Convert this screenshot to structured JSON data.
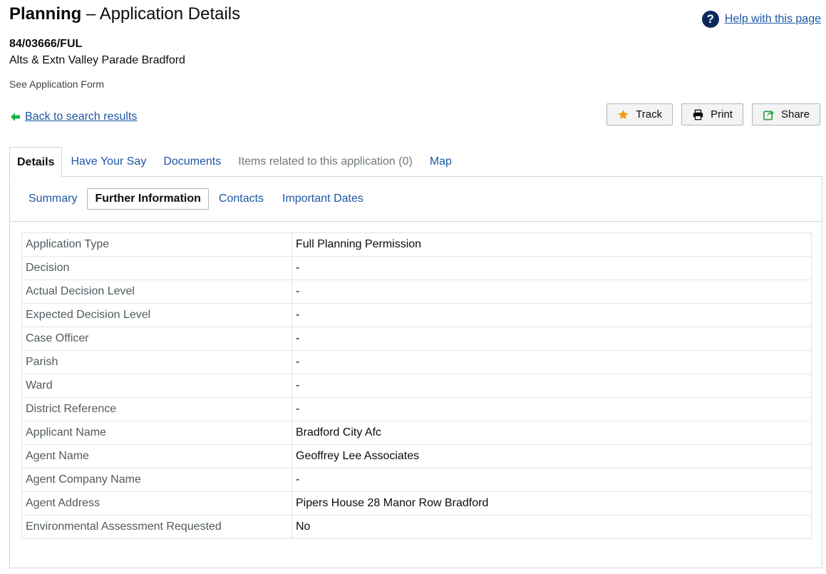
{
  "header": {
    "title_strong": "Planning",
    "title_rest": " – Application Details",
    "help_icon_glyph": "?",
    "help_link": "Help with this page"
  },
  "application": {
    "reference": "84/03666/FUL",
    "description": "Alts & Extn Valley Parade Bradford",
    "see_form": "See Application Form"
  },
  "navigation": {
    "back_link": "Back to search results",
    "back_icon": "arrow-left-icon"
  },
  "actions": {
    "track": "Track",
    "print": "Print",
    "share": "Share",
    "track_icon": "star-icon",
    "print_icon": "printer-icon",
    "share_icon": "share-icon"
  },
  "tabs": [
    {
      "label": "Details"
    },
    {
      "label": "Have Your Say"
    },
    {
      "label": "Documents"
    },
    {
      "label": "Items related to this application (0)"
    },
    {
      "label": "Map"
    }
  ],
  "subtabs": [
    {
      "label": "Summary"
    },
    {
      "label": "Further Information"
    },
    {
      "label": "Contacts"
    },
    {
      "label": "Important Dates"
    }
  ],
  "details": [
    {
      "label": "Application Type",
      "value": "Full Planning Permission"
    },
    {
      "label": "Decision",
      "value": "-"
    },
    {
      "label": "Actual Decision Level",
      "value": "-"
    },
    {
      "label": "Expected Decision Level",
      "value": "-"
    },
    {
      "label": "Case Officer",
      "value": "-"
    },
    {
      "label": "Parish",
      "value": "-"
    },
    {
      "label": "Ward",
      "value": "-"
    },
    {
      "label": "District Reference",
      "value": "-"
    },
    {
      "label": "Applicant Name",
      "value": "Bradford City Afc"
    },
    {
      "label": "Agent Name",
      "value": "Geoffrey Lee Associates"
    },
    {
      "label": "Agent Company Name",
      "value": "-"
    },
    {
      "label": "Agent Address",
      "value": "Pipers House 28 Manor Row Bradford"
    },
    {
      "label": "Environmental Assessment Requested",
      "value": "No"
    }
  ],
  "colors": {
    "link": "#1d57a5",
    "help_icon_bg": "#0b2a5c",
    "star": "#f39c12",
    "share": "#2e9e3f",
    "back_arrow": "#18b44a"
  }
}
